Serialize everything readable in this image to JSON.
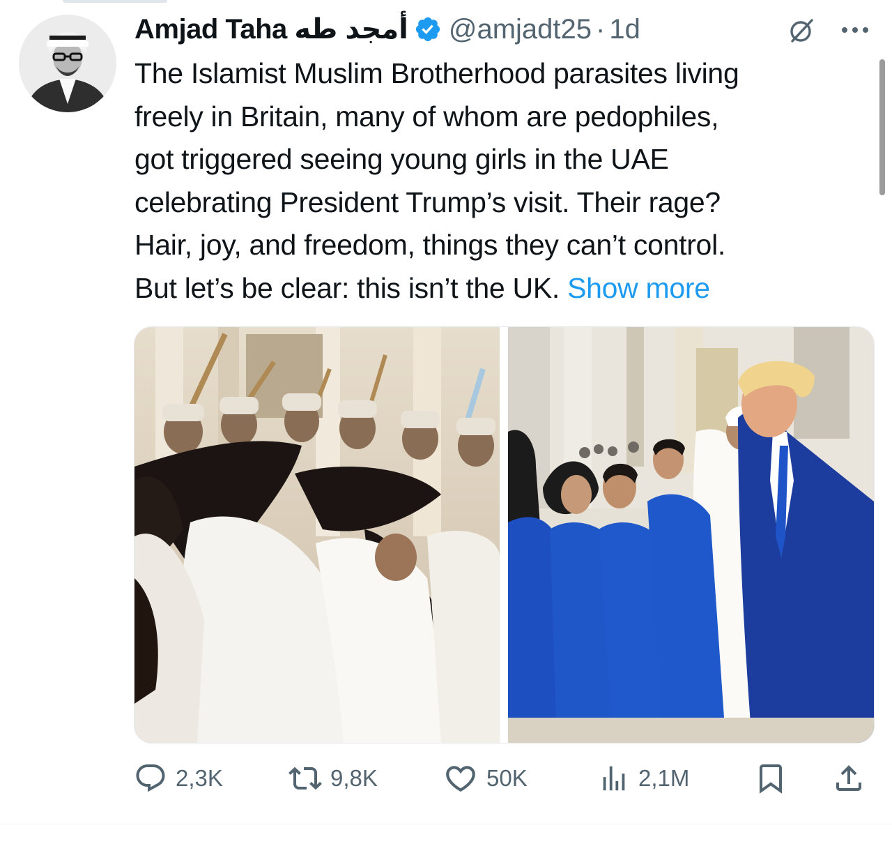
{
  "tweet": {
    "author": {
      "display_name": "Amjad Taha أمجد طه",
      "handle": "@amjadt25",
      "verified": true,
      "separator": "·",
      "time": "1d"
    },
    "text_lines": [
      "The Islamist Muslim Brotherhood parasites living",
      "freely in Britain, many of whom are pedophiles,",
      "got triggered seeing young girls in the UAE",
      "celebrating President Trump’s visit. Their rage?",
      "Hair, joy, and freedom, things they can’t control.",
      "But let’s be clear: this isn’t the UK. "
    ],
    "show_more": "Show more",
    "media": [
      {
        "icon": "photo-women-hair-dance"
      },
      {
        "icon": "photo-trump-students"
      }
    ],
    "actions": {
      "replies": "2,3K",
      "reposts": "9,8K",
      "likes": "50K",
      "views": "2,1M"
    }
  },
  "colors": {
    "link": "#1d9bf0",
    "verified": "#1d9bf0",
    "secondary_text": "#536471",
    "primary_text": "#0f1419",
    "divider": "#eff3f4"
  }
}
